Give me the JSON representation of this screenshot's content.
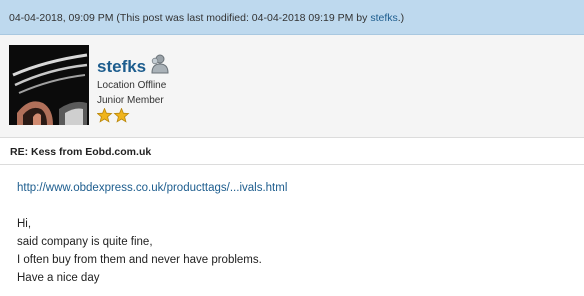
{
  "post": {
    "date": "04-04-2018, 09:09 PM",
    "modified_prefix": "(This post was last modified: 04-04-2018 09:19 PM by ",
    "modified_by": "stefks",
    "modified_suffix": ".)"
  },
  "author": {
    "username": "stefks",
    "status": "Location Offline",
    "rank": "Junior Member",
    "star_count": 2,
    "icons": {
      "avatar": "car-headlight-avatar",
      "presence": "offline-user-icon",
      "rank": "star-icon"
    }
  },
  "subject": "RE: Kess from Eobd.com.uk",
  "body": {
    "link": "http://www.obdexpress.co.uk/producttags/...ivals.html",
    "lines": [
      "Hi,",
      "said company is quite fine,",
      "I often buy from them and never have problems.",
      "Have a nice day"
    ]
  },
  "colors": {
    "header_bg": "#bed9ee",
    "author_bg": "#f5f5f5",
    "link": "#1d5d8e",
    "star": "#f0b41c"
  }
}
